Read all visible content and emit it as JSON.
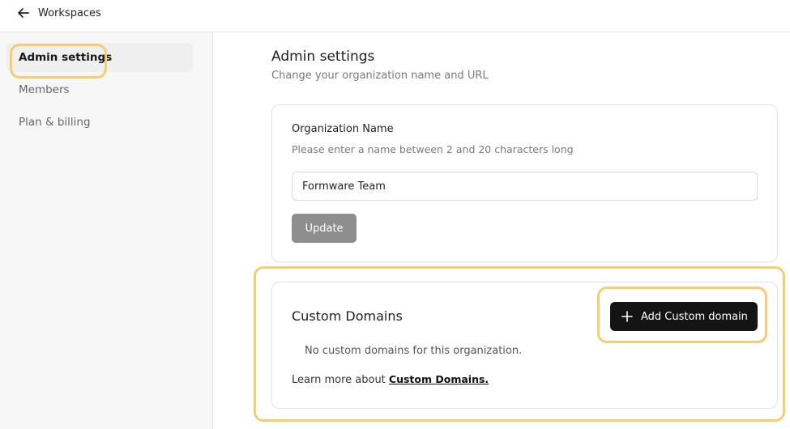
{
  "topbar": {
    "back_label": "Workspaces"
  },
  "sidebar": {
    "items": [
      {
        "label": "Admin settings",
        "active": true
      },
      {
        "label": "Members",
        "active": false
      },
      {
        "label": "Plan & billing",
        "active": false
      }
    ]
  },
  "main": {
    "title": "Admin settings",
    "subtitle": "Change your organization name and URL",
    "org_card": {
      "label": "Organization Name",
      "help": "Please enter a name between 2 and 20 characters long",
      "input_value": "Formware Team",
      "update_label": "Update"
    },
    "domains_card": {
      "title": "Custom Domains",
      "add_button_label": "Add Custom domain",
      "empty_text": "No custom domains for this organization.",
      "learn_prefix": "Learn more about ",
      "learn_link": "Custom Domains."
    }
  },
  "icons": {
    "back": "arrow-left-icon",
    "add": "plus-icon"
  },
  "colors": {
    "highlight": "#f5cd72",
    "primary_button": "#141414",
    "disabled_button": "#8e8e8e"
  }
}
